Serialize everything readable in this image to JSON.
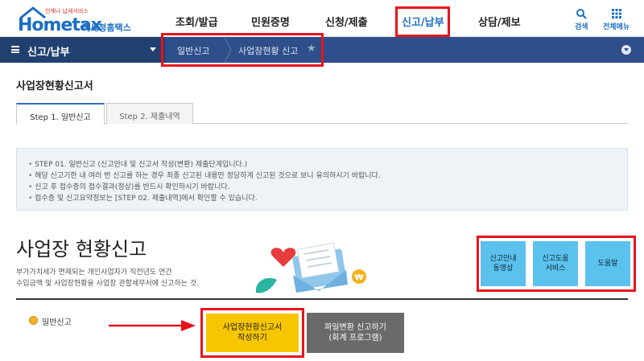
{
  "brand": {
    "name": "Hometax",
    "name_ko": "국세청홈택스",
    "tagline": "언제나 납세서비스"
  },
  "topnav": {
    "items": [
      {
        "label": "조회/발급"
      },
      {
        "label": "민원증명"
      },
      {
        "label": "신청/제출"
      },
      {
        "label": "신고/납부"
      },
      {
        "label": "상담/제보"
      }
    ],
    "search_label": "검색",
    "all_menu_label": "전체메뉴"
  },
  "crumb": {
    "section": "신고/납부",
    "items": [
      "일반신고",
      "사업장현황 신고"
    ]
  },
  "page": {
    "title": "사업장현황신고서"
  },
  "tabs": [
    {
      "label": "Step 1. 일반신고"
    },
    {
      "label": "Step 2. 제출내역"
    }
  ],
  "info": [
    "STEP 01. 일반신고 (신고안내 및 신고서 작성(변환) 제출단계입니다.)",
    "해당 신고기한 내 여러 번 신고를 하는 경우 최종 신고된 내용만 정당하게 신고된 것으로 보니 유의하시기 바랍니다.",
    "신고 후 접수증의 접수결과(정상)를 반드시 확인하시기 바랍니다.",
    "접수증 및 신고요약정보는 [STEP 02. 제출내역]에서 확인할 수 있습니다."
  ],
  "hero": {
    "title": "사업장 현황신고",
    "desc_line1": "부가가치세가 면제되는 개인사업자가 직전년도 연간",
    "desc_line2": "수입금액 및 사업장현황을 사업장 관할세무서에 신고하는 것."
  },
  "side_buttons": [
    {
      "line1": "신고안내",
      "line2": "동영상"
    },
    {
      "line1": "신고도움",
      "line2": "서비스"
    },
    {
      "line1": "도움말",
      "line2": ""
    }
  ],
  "action": {
    "option_label": "일반신고",
    "primary_line1": "사업장현황신고서",
    "primary_line2": "작성하기",
    "secondary_line1": "파일변환 신고하기",
    "secondary_line2": "(회계 프로그램)"
  },
  "colors": {
    "brand_blue": "#1c6fc4",
    "nav_bar": "#2e4f8a",
    "highlight_red": "#e8141b",
    "cta_yellow": "#f7c600",
    "help_blue": "#5bc2ee"
  }
}
